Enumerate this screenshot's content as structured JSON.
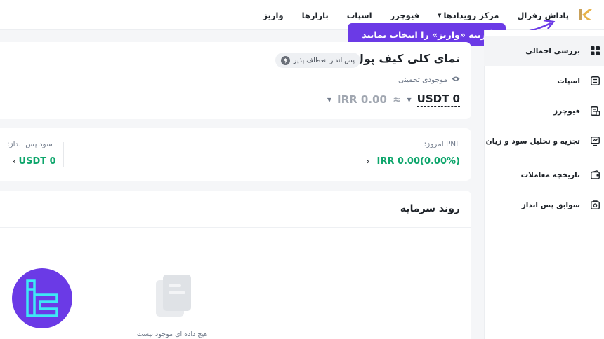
{
  "nav": {
    "deposit": "واریز",
    "markets": "بازارها",
    "spot": "اسپات",
    "futures": "فیوچرز",
    "events": "مرکز رویدادها",
    "referral": "پاداش رفرال"
  },
  "tooltip": "گزینه «واریز» را انتخاب نمایید",
  "sidebar": {
    "items": [
      {
        "label": "بررسی اجمالی",
        "icon": "grid-icon"
      },
      {
        "label": "اسپات",
        "icon": "spot-icon"
      },
      {
        "label": "فیوچرز",
        "icon": "futures-icon"
      },
      {
        "label": "تجزیه و تحلیل سود و زیان",
        "icon": "chart-icon"
      },
      {
        "label": "تاریخچه معاملات",
        "icon": "wallet-icon"
      },
      {
        "label": "سوابق پس انداز",
        "icon": "savings-icon"
      }
    ]
  },
  "overview": {
    "title": "نمای کلی کیف پول",
    "badge": "پس انداز انعطاف پذیر",
    "badge_coin": "$",
    "estimated_label": "موجودی تخمینی",
    "usdt_balance": "USDT 0",
    "approx": "≈",
    "irr_balance": "IRR 0.00"
  },
  "pnl": {
    "label": "PNL امروز:",
    "value": "IRR 0.00(0.00%)",
    "chevron": "›"
  },
  "savings": {
    "label": "سود پس انداز:",
    "value": "USDT 0",
    "chevron": "‹"
  },
  "capital_trend": {
    "title": "روند سرمایه",
    "empty_text": "هیچ داده ای موجود نیست"
  },
  "colors": {
    "accent": "#6b3ae6",
    "positive": "#0ea66c"
  }
}
